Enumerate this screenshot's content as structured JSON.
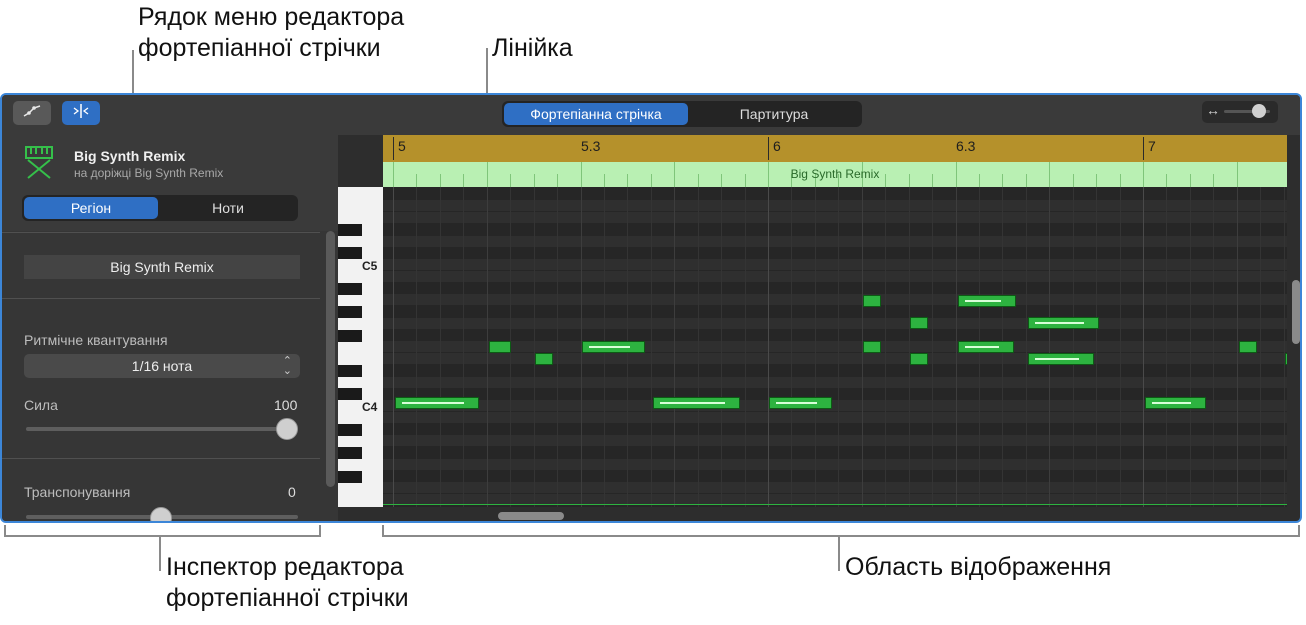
{
  "callouts": {
    "menu_bar": [
      "Рядок меню редактора",
      "фортепіанної стрічки"
    ],
    "ruler": "Лінійка",
    "inspector": [
      "Інспектор редактора",
      "фортепіанної стрічки"
    ],
    "display_area": "Область відображення"
  },
  "toolbar": {
    "automation_button_icon": "automation-curve-icon",
    "catch_button_icon": "playhead-catch-icon",
    "view_tabs": [
      "Фортепіанна стрічка",
      "Партитура"
    ],
    "selected_view": "Фортепіанна стрічка",
    "zoom_icon": "horizontal-zoom-icon"
  },
  "inspector": {
    "track_icon": "synth-keyboard-icon",
    "region_title": "Big Synth Remix",
    "region_subtitle": "на доріжці Big Synth Remix",
    "tabs": [
      "Регіон",
      "Ноти"
    ],
    "selected_tab": "Регіон",
    "region_name": "Big Synth Remix",
    "quantize_label": "Ритмічне квантування",
    "quantize_value": "1/16 нота",
    "strength_label": "Сила",
    "strength_value": "100",
    "transpose_label": "Транспонування",
    "transpose_value": "0"
  },
  "ruler": {
    "labels": [
      "5",
      "5.3",
      "6",
      "6.3",
      "7"
    ]
  },
  "region": {
    "name": "Big Synth Remix"
  },
  "keyboard": {
    "labels": [
      "C5",
      "C4"
    ]
  },
  "colors": {
    "accent": "#2f6fc4",
    "ruler": "#b5912b",
    "region_header": "#b9f0b3",
    "note": "#2db340"
  }
}
